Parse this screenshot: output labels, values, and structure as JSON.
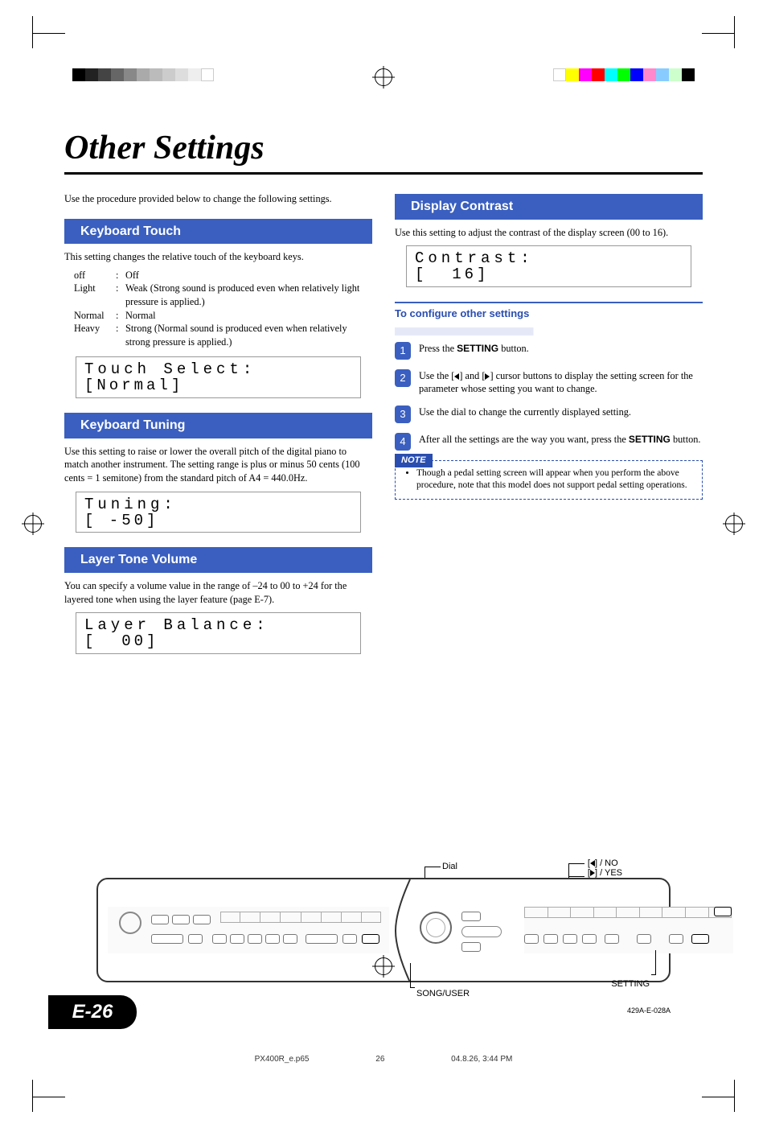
{
  "title": "Other Settings",
  "intro": "Use the procedure provided below to change the following settings.",
  "sections": {
    "touch": {
      "head": "Keyboard Touch",
      "desc": "This setting changes the relative touch of the keyboard keys.",
      "defs": [
        {
          "k": "off",
          "v": "Off"
        },
        {
          "k": "Light",
          "v": "Weak (Strong sound is produced even when relatively light pressure is applied.)"
        },
        {
          "k": "Normal",
          "v": "Normal"
        },
        {
          "k": "Heavy",
          "v": "Strong (Normal sound is produced even when relatively strong pressure is applied.)"
        }
      ],
      "lcd1": "Touch Select:",
      "lcd2": "[Normal]"
    },
    "tuning": {
      "head": "Keyboard Tuning",
      "desc": "Use this setting to raise or lower the overall pitch of the digital piano to match another instrument. The setting range is plus or minus 50 cents (100 cents = 1 semitone) from the standard pitch of A4 = 440.0Hz.",
      "lcd1": "Tuning:",
      "lcd2": "[ -50]"
    },
    "layer": {
      "head": "Layer Tone Volume",
      "desc": "You can specify a volume value in the range of –24 to 00 to +24 for the layered tone when using the layer feature (page E-7).",
      "lcd1": "Layer Balance:",
      "lcd2": "[  00]"
    },
    "contrast": {
      "head": "Display Contrast",
      "desc": "Use this setting to adjust the contrast of the display screen (00 to 16).",
      "lcd1": "Contrast:",
      "lcd2": "[  16]"
    }
  },
  "configure": {
    "subhead": "To configure other settings",
    "steps": [
      {
        "pre": "Press the ",
        "bold": "SETTING",
        "post": " button."
      },
      {
        "text": "Use the [◀] and [▶] cursor buttons to display the setting screen for the parameter whose setting you want to change."
      },
      {
        "text": "Use the dial to change the currently displayed setting."
      },
      {
        "pre": "After all the settings are the way you want, press the ",
        "bold": "SETTING",
        "post": " button."
      }
    ]
  },
  "note": {
    "label": "NOTE",
    "text": "Though a pedal setting screen will appear when you perform the above procedure, note that this model does not support pedal setting operations."
  },
  "diagram": {
    "dial": "Dial",
    "no": "[◀] / NO",
    "yes": "[▶] / YES",
    "songuser": "SONG/USER",
    "setting": "SETTING"
  },
  "page_num": "E-26",
  "doc_code": "429A-E-028A",
  "footer": {
    "file": "PX400R_e.p65",
    "page": "26",
    "date": "04.8.26, 3:44 PM"
  }
}
